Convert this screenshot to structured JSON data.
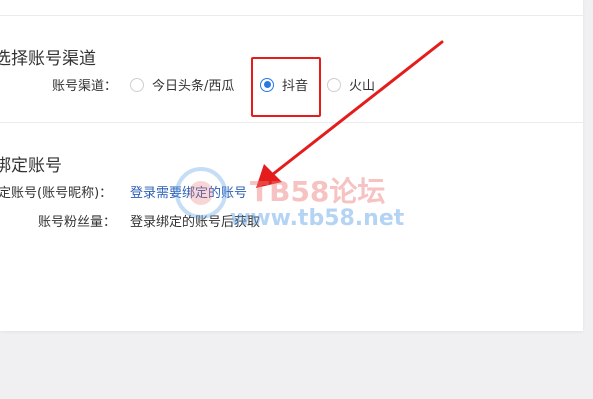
{
  "section_channel": {
    "title": "选择账号渠道",
    "label": "账号渠道：",
    "options": [
      {
        "label": "今日头条/西瓜",
        "checked": false
      },
      {
        "label": "抖音",
        "checked": true
      },
      {
        "label": "火山",
        "checked": false
      }
    ]
  },
  "section_bind": {
    "title": "绑定账号",
    "account_label": "定账号(账号昵称)：",
    "account_value": "登录需要绑定的账号",
    "fans_label": "账号粉丝量：",
    "fans_value": "登录绑定的账号后获取"
  },
  "watermark": {
    "text_main": "TB58论坛",
    "text_url": "www.tb58.net"
  },
  "colors": {
    "accent": "#2d76e6",
    "link": "#2d5fb5",
    "annotation_red": "#e51c1c"
  }
}
